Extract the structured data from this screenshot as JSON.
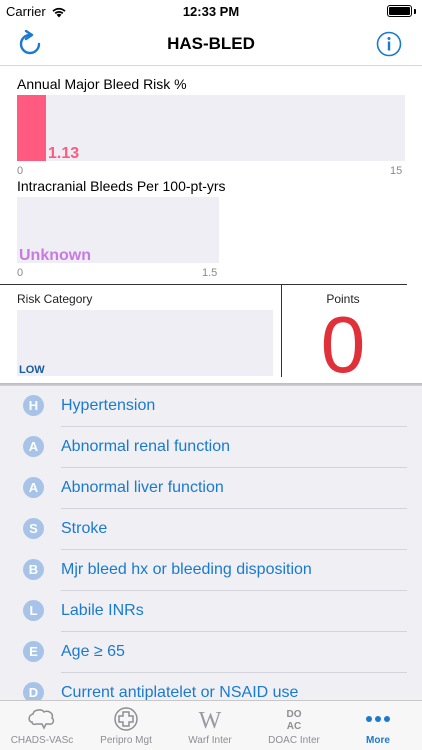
{
  "status": {
    "carrier": "Carrier",
    "time": "12:33 PM"
  },
  "nav": {
    "title": "HAS-BLED",
    "refresh_icon": "refresh-icon",
    "info_icon": "info-icon"
  },
  "bleed_risk": {
    "label": "Annual Major Bleed Risk %",
    "value": "1.13",
    "min": "0",
    "max": "15",
    "fraction": 0.0753,
    "bar_color": "#ff5a80"
  },
  "intracranial": {
    "label": "Intracranial Bleeds Per 100-pt-yrs",
    "value": "Unknown",
    "min": "0",
    "max": "1.5",
    "value_color": "#c87ae0"
  },
  "risk_category": {
    "label": "Risk Category",
    "value": "LOW"
  },
  "points": {
    "label": "Points",
    "value": "0",
    "color": "#e0313a"
  },
  "criteria": [
    {
      "letter": "H",
      "label": "Hypertension"
    },
    {
      "letter": "A",
      "label": "Abnormal renal function"
    },
    {
      "letter": "A",
      "label": "Abnormal liver function"
    },
    {
      "letter": "S",
      "label": "Stroke"
    },
    {
      "letter": "B",
      "label": "Mjr bleed hx or bleeding disposition"
    },
    {
      "letter": "L",
      "label": "Labile INRs"
    },
    {
      "letter": "E",
      "label": "Age ≥ 65"
    },
    {
      "letter": "D",
      "label": "Current antiplatelet or NSAID use"
    }
  ],
  "tabs": [
    {
      "label": "CHADS-VASc",
      "icon": "brain-icon",
      "active": false
    },
    {
      "label": "Peripro Mgt",
      "icon": "medical-cross-icon",
      "active": false
    },
    {
      "label": "Warf Inter",
      "icon": "warfarin-w-icon",
      "active": false
    },
    {
      "label": "DOAC Inter",
      "icon": "doac-icon",
      "active": false
    },
    {
      "label": "More",
      "icon": "more-dots-icon",
      "active": true
    }
  ],
  "colors": {
    "accent": "#1a7ad0",
    "list_background": "#efeff4",
    "chart_background": "#efeef5"
  }
}
